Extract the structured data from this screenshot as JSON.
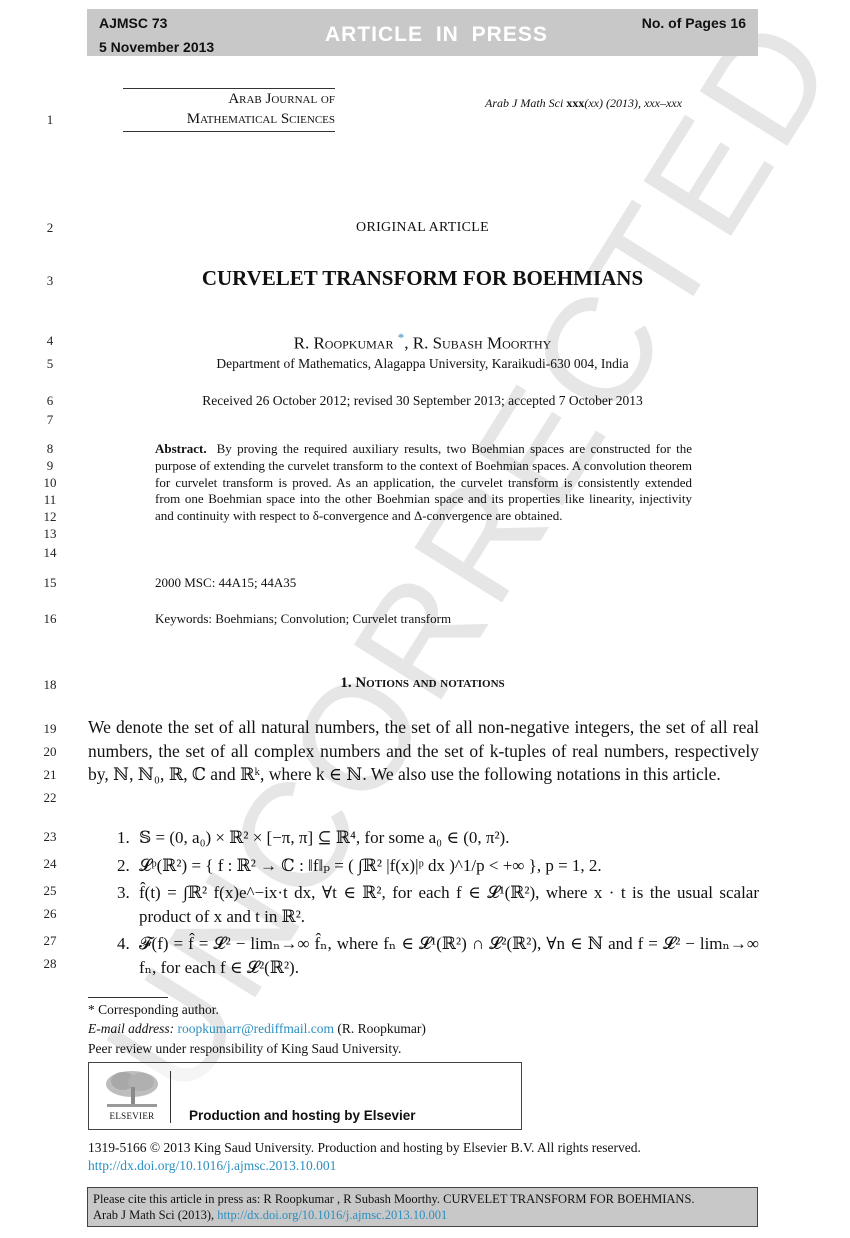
{
  "header": {
    "code": "AJMSC 73",
    "date": "5 November 2013",
    "status": "ARTICLE IN PRESS",
    "pages": "No. of Pages 16"
  },
  "journal": {
    "name_line1": "Arab Journal of",
    "name_line2": "Mathematical Sciences",
    "citation_prefix": "Arab J Math Sci ",
    "citation_volume": "xxx",
    "citation_suffix": "(xx) (2013), xxx–xxx"
  },
  "line_numbers": [
    "1",
    "2",
    "3",
    "4",
    "5",
    "6",
    "7",
    "8",
    "9",
    "10",
    "11",
    "12",
    "13",
    "14",
    "15",
    "16",
    "18",
    "19",
    "20",
    "21",
    "22",
    "23",
    "24",
    "25",
    "26",
    "27",
    "28"
  ],
  "article": {
    "type": "ORIGINAL ARTICLE",
    "title": "CURVELET TRANSFORM FOR BOEHMIANS",
    "author1": "R. Roopkumar",
    "author_star": "*",
    "author2": ", R. Subash Moorthy",
    "affiliation": "Department of Mathematics, Alagappa University, Karaikudi-630 004, India",
    "dates": "Received 26 October 2012; revised 30 September 2013; accepted 7 October 2013",
    "abstract_label": "Abstract.",
    "abstract_text": "By proving the required auxiliary results, two Boehmian spaces are constructed for the purpose of extending the curvelet transform to the context of Boehmian spaces. A convolution theorem for curvelet transform is proved. As an application, the curvelet transform is consistently extended from one Boehmian space into the other Boehmian space and its properties like linearity, injectivity and continuity with respect to δ-convergence and Δ-convergence are obtained.",
    "msc": "2000 MSC:  44A15; 44A35",
    "keywords": "Keywords:  Boehmians; Convolution; Curvelet transform"
  },
  "section": {
    "title": "1. Notions and notations",
    "intro": "We denote the set of all natural numbers, the set of all non-negative integers, the set of all real numbers, the set of all complex numbers and the set of k-tuples of real numbers, respectively by, ℕ, ℕ₀, ℝ, ℂ and ℝᵏ, where k ∈ ℕ. We also use the following notations in this article.",
    "items": [
      {
        "num": "1.",
        "text": "𝕊 = (0, a₀) × ℝ² × [−π, π] ⊆ ℝ⁴, for some a₀ ∈ (0, π²)."
      },
      {
        "num": "2.",
        "text": "𝓛ᵖ(ℝ²) = { f : ℝ² → ℂ : ‖f‖ₚ = ( ∫ℝ² |f(x)|ᵖ dx )^1/p < +∞ }, p = 1, 2."
      },
      {
        "num": "3.",
        "text": "f̂(t) = ∫ℝ² f(x)e^−ix·t dx, ∀t ∈ ℝ², for each f ∈ 𝓛¹(ℝ²), where x · t is the usual scalar product of x and t in ℝ²."
      },
      {
        "num": "4.",
        "text": "𝓕(f) = f̂ = 𝓛² − limₙ→∞ f̂ₙ,  where  fₙ ∈ 𝓛¹(ℝ²) ∩ 𝓛²(ℝ²), ∀n ∈ ℕ  and  f = 𝓛² − limₙ→∞ fₙ, for each f ∈ 𝓛²(ℝ²)."
      }
    ]
  },
  "footnotes": {
    "corresponding": "* Corresponding author.",
    "email_label": "E-mail address: ",
    "email": "roopkumarr@rediffmail.com",
    "email_suffix": " (R. Roopkumar)",
    "peer_review": "Peer review under responsibility of King Saud University."
  },
  "publisher": {
    "logo_text": "ELSEVIER",
    "hosting": "Production and hosting by Elsevier",
    "copyright": "1319-5166 © 2013 King Saud University. Production and hosting by Elsevier B.V. All rights reserved.",
    "doi": "http://dx.doi.org/10.1016/j.ajmsc.2013.10.001"
  },
  "cite_box": {
    "text1": "Please cite this article in press as: R Roopkumar , R Subash Moorthy. CURVELET TRANSFORM FOR BOEHMIANS.",
    "text2": "Arab J Math Sci (2013), ",
    "doi": "http://dx.doi.org/10.1016/j.ajmsc.2013.10.001"
  },
  "watermark": "UNCORRECTED PROOF",
  "colors": {
    "link": "#2a8fc0",
    "header_bar": "#c8c8c8",
    "watermark": "#e6e6e6"
  }
}
